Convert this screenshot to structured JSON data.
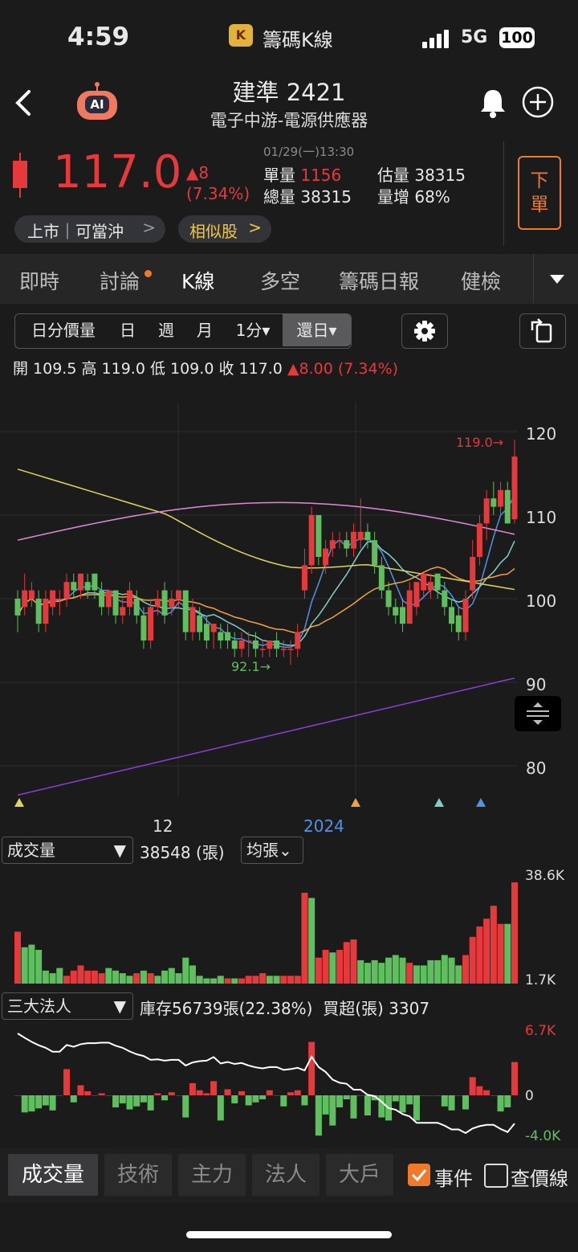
{
  "status_bar": {
    "time": "4:59",
    "app_name": "籌碼K線",
    "network": "5G",
    "battery": "100"
  },
  "header": {
    "stock_name": "建準 2421",
    "industry": "電子中游-電源供應器",
    "ai_badge": "AI"
  },
  "quote": {
    "price": "117.0",
    "change": "▲8",
    "change_pct": "(7.34%)",
    "datetime": "01/29(一)13:30",
    "unit_vol_label": "單量",
    "unit_vol": "1156",
    "est_vol_label": "估量",
    "est_vol": "38315",
    "total_vol_label": "總量",
    "total_vol": "38315",
    "vol_inc_label": "量增",
    "vol_inc": "68%",
    "order_button": "下單"
  },
  "tags": {
    "market": "上市｜可當沖",
    "market_arrow": ">",
    "similar": "相似股",
    "similar_arrow": ">"
  },
  "tabs": [
    "即時",
    "討論",
    "K線",
    "多空",
    "籌碼日報",
    "健檢"
  ],
  "period_selector": {
    "items": [
      "日分價量",
      "日",
      "週",
      "月",
      "1分▾"
    ],
    "selected": "還日▾"
  },
  "ohlc": {
    "open": "開 109.5",
    "high": "高 119.0",
    "low": "低 109.0",
    "close": "收 117.0",
    "change": "▲8.00 (7.34%)"
  },
  "chart_labels": {
    "y_ticks": [
      "120",
      "110",
      "100",
      "90",
      "80"
    ],
    "x_ticks": [
      "12",
      "2024"
    ],
    "high_marker": "119.0→",
    "low_marker": "92.1→"
  },
  "volume_panel": {
    "selector": "成交量",
    "selector_arrow": "▼",
    "value": "38548 (張)",
    "avg_button": "均張⌄",
    "max_label": "38.6K",
    "min_label": "1.7K"
  },
  "inst_panel": {
    "selector": "三大法人",
    "selector_arrow": "▼",
    "info": "庫存56739張(22.38%)  買超(張) 3307",
    "max_label": "6.7K",
    "zero_label": "0",
    "min_label": "-4.0K"
  },
  "bottom_tabs": [
    "成交量",
    "技術",
    "主力",
    "法人",
    "大戶"
  ],
  "bottom_options": {
    "event_label": "事件",
    "event_checked": true,
    "price_line_label": "查價線",
    "price_line_checked": false
  },
  "colors": {
    "up": "#e5393c",
    "down": "#5fbf5f",
    "accent": "#f07a2a",
    "ma5": "#4f93e8",
    "ma10": "#7fd1c7",
    "ma20": "#f0a23c",
    "ma60": "#e0d45a",
    "ma120": "#e08ad8",
    "ma240": "#8a3fd9"
  },
  "chart_data": {
    "type": "candlestick",
    "y_range": [
      76,
      123
    ],
    "candles": [
      [
        100,
        98,
        101,
        96
      ],
      [
        99,
        101,
        103,
        98
      ],
      [
        100,
        101,
        102,
        99
      ],
      [
        100,
        97,
        101,
        96
      ],
      [
        97,
        100,
        101,
        96
      ],
      [
        99,
        101,
        101,
        98
      ],
      [
        100,
        100,
        101,
        98
      ],
      [
        100,
        102,
        103,
        99
      ],
      [
        102,
        101,
        103,
        100
      ],
      [
        101,
        103,
        103,
        100
      ],
      [
        102,
        101,
        103,
        100
      ],
      [
        103,
        101,
        103,
        100
      ],
      [
        101,
        99,
        102,
        98
      ],
      [
        99,
        101,
        101,
        98
      ],
      [
        101,
        98,
        101,
        97
      ],
      [
        98,
        99,
        100,
        97
      ],
      [
        99,
        101,
        102,
        98
      ],
      [
        100,
        98,
        101,
        97
      ],
      [
        98,
        95,
        99,
        94
      ],
      [
        95,
        99,
        100,
        94
      ],
      [
        99,
        100,
        101,
        98
      ],
      [
        101,
        98,
        102,
        97
      ],
      [
        99,
        100,
        101,
        98
      ],
      [
        100,
        101,
        101,
        99
      ],
      [
        101,
        96,
        101,
        95
      ],
      [
        96,
        99,
        100,
        95
      ],
      [
        98,
        96,
        99,
        95
      ],
      [
        97,
        95,
        98,
        94
      ],
      [
        96,
        97,
        97,
        94
      ],
      [
        96,
        95,
        97,
        94
      ],
      [
        96,
        95,
        97,
        94
      ],
      [
        95,
        94,
        96,
        93
      ],
      [
        94,
        95,
        96,
        93
      ],
      [
        95,
        95,
        96,
        93
      ],
      [
        95,
        94,
        96,
        93
      ],
      [
        94,
        94,
        95,
        93
      ],
      [
        94,
        95,
        95,
        93
      ],
      [
        95,
        94,
        96,
        93
      ],
      [
        94,
        94,
        95,
        93
      ],
      [
        94,
        94,
        95,
        92.1
      ],
      [
        94,
        96,
        97,
        93
      ],
      [
        101,
        104,
        106,
        100
      ],
      [
        104,
        110,
        111,
        103
      ],
      [
        110,
        105,
        110,
        104
      ],
      [
        104,
        106,
        107,
        103
      ],
      [
        106,
        107,
        108,
        105
      ],
      [
        107,
        107,
        108,
        106
      ],
      [
        107,
        106,
        108,
        105
      ],
      [
        106,
        108,
        109,
        105
      ],
      [
        107,
        108,
        112,
        106
      ],
      [
        108,
        107,
        109,
        106
      ],
      [
        107,
        104,
        108,
        103
      ],
      [
        104,
        101,
        105,
        100
      ],
      [
        101,
        99,
        102,
        98
      ],
      [
        99,
        98,
        100,
        97
      ],
      [
        99,
        97,
        100,
        96
      ],
      [
        97,
        101,
        102,
        97
      ],
      [
        99,
        102,
        102,
        98
      ],
      [
        101,
        103,
        103,
        100
      ],
      [
        101,
        102,
        103,
        100
      ],
      [
        103,
        101,
        103,
        100
      ],
      [
        101,
        99,
        102,
        98
      ],
      [
        99,
        97,
        100,
        96
      ],
      [
        98,
        96,
        99,
        95
      ],
      [
        96,
        100,
        101,
        95
      ],
      [
        101,
        105,
        107,
        100
      ],
      [
        105,
        109,
        110,
        104
      ],
      [
        109,
        112,
        113,
        107
      ],
      [
        112,
        111,
        114,
        110
      ],
      [
        111,
        113,
        114,
        110
      ],
      [
        113,
        109,
        114,
        109
      ],
      [
        109.5,
        117,
        119,
        109
      ]
    ],
    "volume": [
      [
        1,
        20
      ],
      [
        0,
        14
      ],
      [
        0,
        15
      ],
      [
        0,
        13
      ],
      [
        0,
        5
      ],
      [
        0,
        4
      ],
      [
        0,
        6
      ],
      [
        1,
        3
      ],
      [
        1,
        5
      ],
      [
        1,
        7
      ],
      [
        1,
        5
      ],
      [
        1,
        5
      ],
      [
        1,
        4
      ],
      [
        0,
        6
      ],
      [
        0,
        5
      ],
      [
        0,
        4
      ],
      [
        0,
        3
      ],
      [
        1,
        4
      ],
      [
        0,
        5
      ],
      [
        1,
        4
      ],
      [
        0,
        3
      ],
      [
        0,
        5
      ],
      [
        0,
        6
      ],
      [
        0,
        4
      ],
      [
        0,
        10
      ],
      [
        0,
        7
      ],
      [
        0,
        3
      ],
      [
        0,
        2
      ],
      [
        0,
        2
      ],
      [
        0,
        3
      ],
      [
        1,
        2
      ],
      [
        0,
        2
      ],
      [
        1,
        2
      ],
      [
        1,
        3
      ],
      [
        1,
        3
      ],
      [
        1,
        4
      ],
      [
        0,
        3
      ],
      [
        0,
        3
      ],
      [
        1,
        3
      ],
      [
        1,
        3
      ],
      [
        1,
        3
      ],
      [
        1,
        35
      ],
      [
        0,
        33
      ],
      [
        1,
        10
      ],
      [
        1,
        13
      ],
      [
        0,
        12
      ],
      [
        1,
        13
      ],
      [
        1,
        16
      ],
      [
        1,
        17
      ],
      [
        0,
        9
      ],
      [
        0,
        8
      ],
      [
        0,
        9
      ],
      [
        0,
        8
      ],
      [
        0,
        10
      ],
      [
        0,
        11
      ],
      [
        0,
        10
      ],
      [
        1,
        8
      ],
      [
        0,
        7
      ],
      [
        0,
        7
      ],
      [
        0,
        9
      ],
      [
        0,
        9
      ],
      [
        0,
        11
      ],
      [
        0,
        10
      ],
      [
        0,
        7
      ],
      [
        1,
        11
      ],
      [
        1,
        18
      ],
      [
        1,
        22
      ],
      [
        1,
        25
      ],
      [
        1,
        30
      ],
      [
        1,
        23
      ],
      [
        0,
        23
      ],
      [
        1,
        39
      ]
    ],
    "institutional": [
      0,
      -1.7,
      -1.6,
      -1.3,
      -1,
      -1.5,
      0,
      2.6,
      -0.7,
      1,
      0.4,
      0,
      0.2,
      0,
      -1.2,
      -0.8,
      -1.4,
      -1.1,
      -0.7,
      -1.5,
      0.2,
      -0.5,
      0.3,
      0,
      -2.2,
      1.2,
      0.5,
      0.2,
      1.4,
      -2.5,
      0.6,
      -0.8,
      0.4,
      -1,
      -0.7,
      -0.4,
      0.5,
      0,
      -1.1,
      0.3,
      0.5,
      -1,
      5.3,
      -4,
      -1.9,
      -3,
      -1.2,
      -0.4,
      -2.3,
      0,
      -2,
      -0.5,
      -2.2,
      -2.5,
      -0.6,
      -1.7,
      -0.9,
      -2.5,
      0,
      0,
      0,
      -1.1,
      -1.5,
      0,
      -1.4,
      1.8,
      0.9,
      0.5,
      0,
      -1.6,
      -1.2,
      3.3
    ]
  }
}
